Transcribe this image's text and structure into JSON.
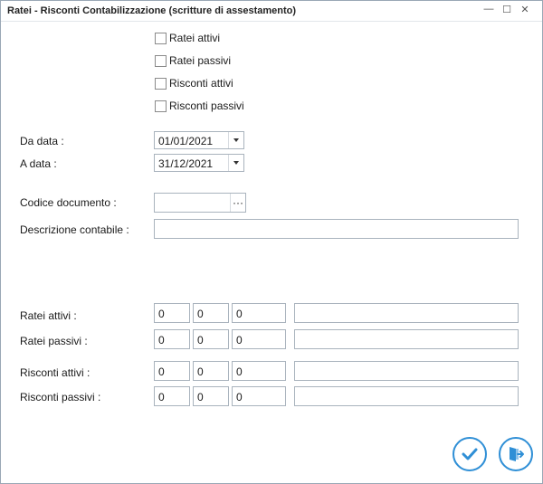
{
  "window": {
    "title": "Ratei - Risconti Contabilizzazione (scritture di assestamento)",
    "controls": {
      "minimize": "—",
      "maximize": "☐",
      "close": "✕"
    }
  },
  "checkboxes": [
    {
      "label": "Ratei attivi",
      "checked": false
    },
    {
      "label": "Ratei passivi",
      "checked": false
    },
    {
      "label": "Risconti attivi",
      "checked": false
    },
    {
      "label": "Risconti passivi",
      "checked": false
    }
  ],
  "dates": {
    "from_label": "Da data :",
    "from_value": "01/01/2021",
    "to_label": "A data :",
    "to_value": "31/12/2021"
  },
  "document": {
    "code_label": "Codice documento :",
    "code_value": "",
    "code_button": "···",
    "description_label": "Descrizione contabile :",
    "description_value": ""
  },
  "rows": [
    {
      "label": "Ratei attivi :",
      "v1": "0",
      "v2": "0",
      "v3": "0",
      "text": ""
    },
    {
      "label": "Ratei passivi :",
      "v1": "0",
      "v2": "0",
      "v3": "0",
      "text": ""
    },
    {
      "label": "Risconti attivi :",
      "v1": "0",
      "v2": "0",
      "v3": "0",
      "text": ""
    },
    {
      "label": "Risconti passivi :",
      "v1": "0",
      "v2": "0",
      "v3": "0",
      "text": ""
    }
  ],
  "actions": {
    "confirm_icon": "check-icon",
    "exit_icon": "exit-door-icon"
  },
  "colors": {
    "accent": "#2f8fd6",
    "border": "#a9b3bd"
  }
}
